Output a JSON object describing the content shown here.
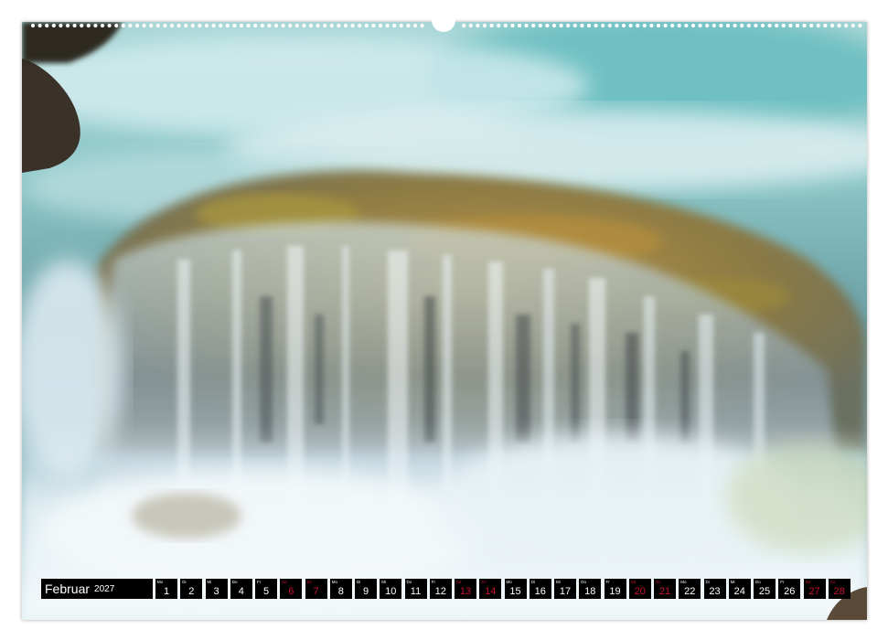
{
  "calendar": {
    "month": "Februar",
    "year": "2027",
    "weekend_color": "#c8102e",
    "days": [
      {
        "abbr": "Mo",
        "num": "1",
        "weekend": false
      },
      {
        "abbr": "Di",
        "num": "2",
        "weekend": false
      },
      {
        "abbr": "Mi",
        "num": "3",
        "weekend": false
      },
      {
        "abbr": "Do",
        "num": "4",
        "weekend": false
      },
      {
        "abbr": "Fr",
        "num": "5",
        "weekend": false
      },
      {
        "abbr": "Sa",
        "num": "6",
        "weekend": true
      },
      {
        "abbr": "So",
        "num": "7",
        "weekend": true
      },
      {
        "abbr": "Mo",
        "num": "8",
        "weekend": false
      },
      {
        "abbr": "Di",
        "num": "9",
        "weekend": false
      },
      {
        "abbr": "Mi",
        "num": "10",
        "weekend": false
      },
      {
        "abbr": "Do",
        "num": "11",
        "weekend": false
      },
      {
        "abbr": "Fr",
        "num": "12",
        "weekend": false
      },
      {
        "abbr": "Sa",
        "num": "13",
        "weekend": true
      },
      {
        "abbr": "So",
        "num": "14",
        "weekend": true
      },
      {
        "abbr": "Mo",
        "num": "15",
        "weekend": false
      },
      {
        "abbr": "Di",
        "num": "16",
        "weekend": false
      },
      {
        "abbr": "Mi",
        "num": "17",
        "weekend": false
      },
      {
        "abbr": "Do",
        "num": "18",
        "weekend": false
      },
      {
        "abbr": "Fr",
        "num": "19",
        "weekend": false
      },
      {
        "abbr": "Sa",
        "num": "20",
        "weekend": true
      },
      {
        "abbr": "So",
        "num": "21",
        "weekend": true
      },
      {
        "abbr": "Mo",
        "num": "22",
        "weekend": false
      },
      {
        "abbr": "Di",
        "num": "23",
        "weekend": false
      },
      {
        "abbr": "Mi",
        "num": "24",
        "weekend": false
      },
      {
        "abbr": "Do",
        "num": "25",
        "weekend": false
      },
      {
        "abbr": "Fr",
        "num": "26",
        "weekend": false
      },
      {
        "abbr": "Sa",
        "num": "27",
        "weekend": true
      },
      {
        "abbr": "So",
        "num": "28",
        "weekend": true
      }
    ]
  },
  "photo": {
    "subject": "waterfall-over-mossy-rock",
    "palette": {
      "water_light": "#e6f3f4",
      "water_teal": "#7fc2c4",
      "water_deep": "#3d6e78",
      "rock_moss": "#a88a3c",
      "rock_dark": "#3a3128"
    }
  }
}
